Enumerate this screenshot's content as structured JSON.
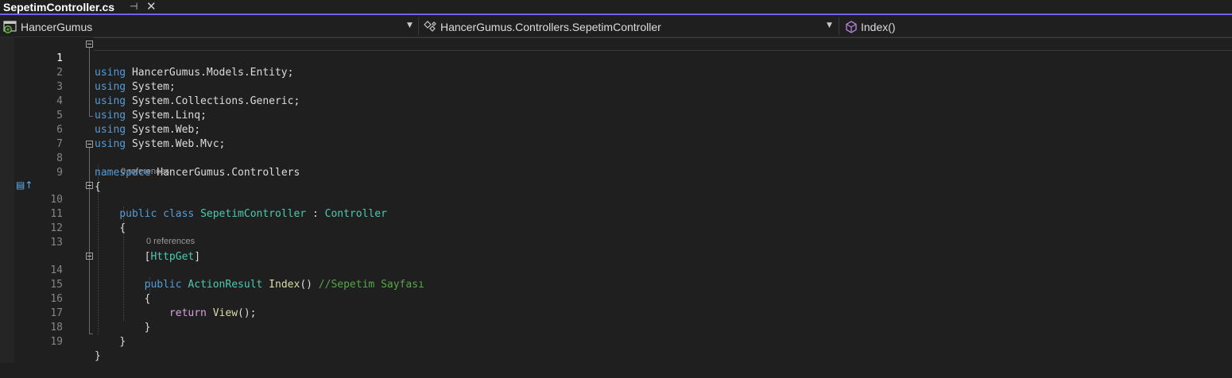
{
  "tab": {
    "title": "SepetimController.cs",
    "pin_icon": "pin-icon",
    "close_icon": "close-icon"
  },
  "navbar": {
    "project": "HancerGumus",
    "type": "HancerGumus.Controllers.SepetimController",
    "member": "Index()"
  },
  "editor": {
    "lines": [
      {
        "num": "1"
      },
      {
        "num": "2"
      },
      {
        "num": "3"
      },
      {
        "num": "4"
      },
      {
        "num": "5"
      },
      {
        "num": "6"
      },
      {
        "num": "7"
      },
      {
        "num": "8"
      },
      {
        "num": "9"
      },
      {
        "num": "10"
      },
      {
        "num": "11"
      },
      {
        "num": "12"
      },
      {
        "num": "13"
      },
      {
        "num": "14"
      },
      {
        "num": "15"
      },
      {
        "num": "16"
      },
      {
        "num": "17"
      },
      {
        "num": "18"
      },
      {
        "num": "19"
      }
    ],
    "tokens": {
      "using": "using",
      "ns1": "HancerGumus.Models.Entity;",
      "ns2": "System;",
      "ns3": "System.Collections.Generic;",
      "ns4": "System.Linq;",
      "ns5": "System.Web;",
      "ns6": "System.Web.Mvc;",
      "namespace_kw": "namespace",
      "namespace_name": "HancerGumus.Controllers",
      "open_brace": "{",
      "close_brace": "}",
      "public": "public",
      "class": "class",
      "class_name": "SepetimController",
      "colon": " : ",
      "base_class": "Controller",
      "attr_open": "[",
      "attr_name": "HttpGet",
      "attr_close": "]",
      "return_type": "ActionResult",
      "method_name": "Index",
      "parens": "()",
      "comment": "//Sepetim Sayfası",
      "return_kw": "return",
      "view_fn": "View",
      "call_end": "();"
    },
    "codelens_class": "0 references",
    "codelens_method": "0 references"
  }
}
